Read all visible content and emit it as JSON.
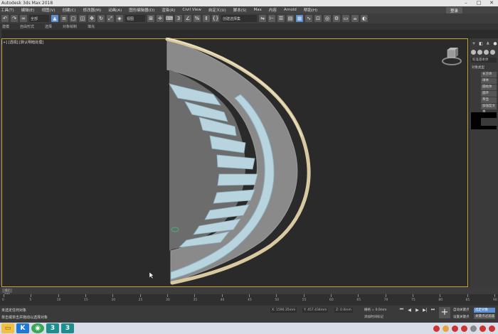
{
  "window": {
    "title": "Autodesk 3ds Max 2018",
    "minimize": "–",
    "maximize": "□",
    "close": "✕"
  },
  "menubar": {
    "items": [
      "工具(T)",
      "编辑(E)",
      "视图(V)",
      "创建(C)",
      "修改器(M)",
      "动画(A)",
      "图形编辑器(D)",
      "渲染(R)",
      "Civil View",
      "自定义(U)",
      "脚本(S)",
      "Max",
      "内容",
      "Arnold",
      "帮助(H)"
    ],
    "login": "登录"
  },
  "toolbar": {
    "selection_filter": "全部",
    "view_dropdown": "视图",
    "named_selection": "创建选择集",
    "icons": [
      "undo-icon",
      "redo-icon",
      "link-icon",
      "unlink-icon",
      "select-icon",
      "move-icon",
      "rotate-icon",
      "scale-icon",
      "snap-icon",
      "mirror-icon",
      "align-icon",
      "render-icon"
    ]
  },
  "subtabs": [
    "建模",
    "自由形式",
    "选择",
    "对象绘制",
    "填充"
  ],
  "viewport": {
    "label": "[+] [透视] [默认明暗处理]"
  },
  "command_panel": {
    "category": "标准基本体",
    "object_type": "对象类型",
    "buttons": [
      "长方体",
      "球体",
      "圆柱体",
      "圆环",
      "茶壶",
      "加强型文本"
    ]
  },
  "timeline": {
    "slider": "0 / 100",
    "ticks": [
      0,
      5,
      10,
      15,
      20,
      25,
      30,
      35,
      40,
      45,
      50,
      55,
      60,
      65,
      70,
      75,
      80,
      85,
      90
    ]
  },
  "status": {
    "line1": "未选定任何对象",
    "line2": "单击或单击并拖动以选择对象",
    "x": "X: 1590.35mm",
    "y": "Y: 457.434mm",
    "z": "Z: 0.0mm",
    "grid": "栅格 = 0.0mm",
    "add_time_tag": "添加时间标记",
    "auto_key": "自动关键点",
    "set_key": "设置关键点",
    "key_filter": "选定对象",
    "key_filters": "关键点过滤器"
  },
  "taskbar": {
    "items": [
      "file-explorer-icon",
      "kugou-icon",
      "chrome-icon",
      "3dsmax-icon",
      "3dsmax-icon-2"
    ]
  },
  "colors": {
    "accent": "#5b8fd1",
    "viewport_border": "#c7a33a",
    "stair": "#b8d4de",
    "handrail": "#d8c9a0"
  }
}
